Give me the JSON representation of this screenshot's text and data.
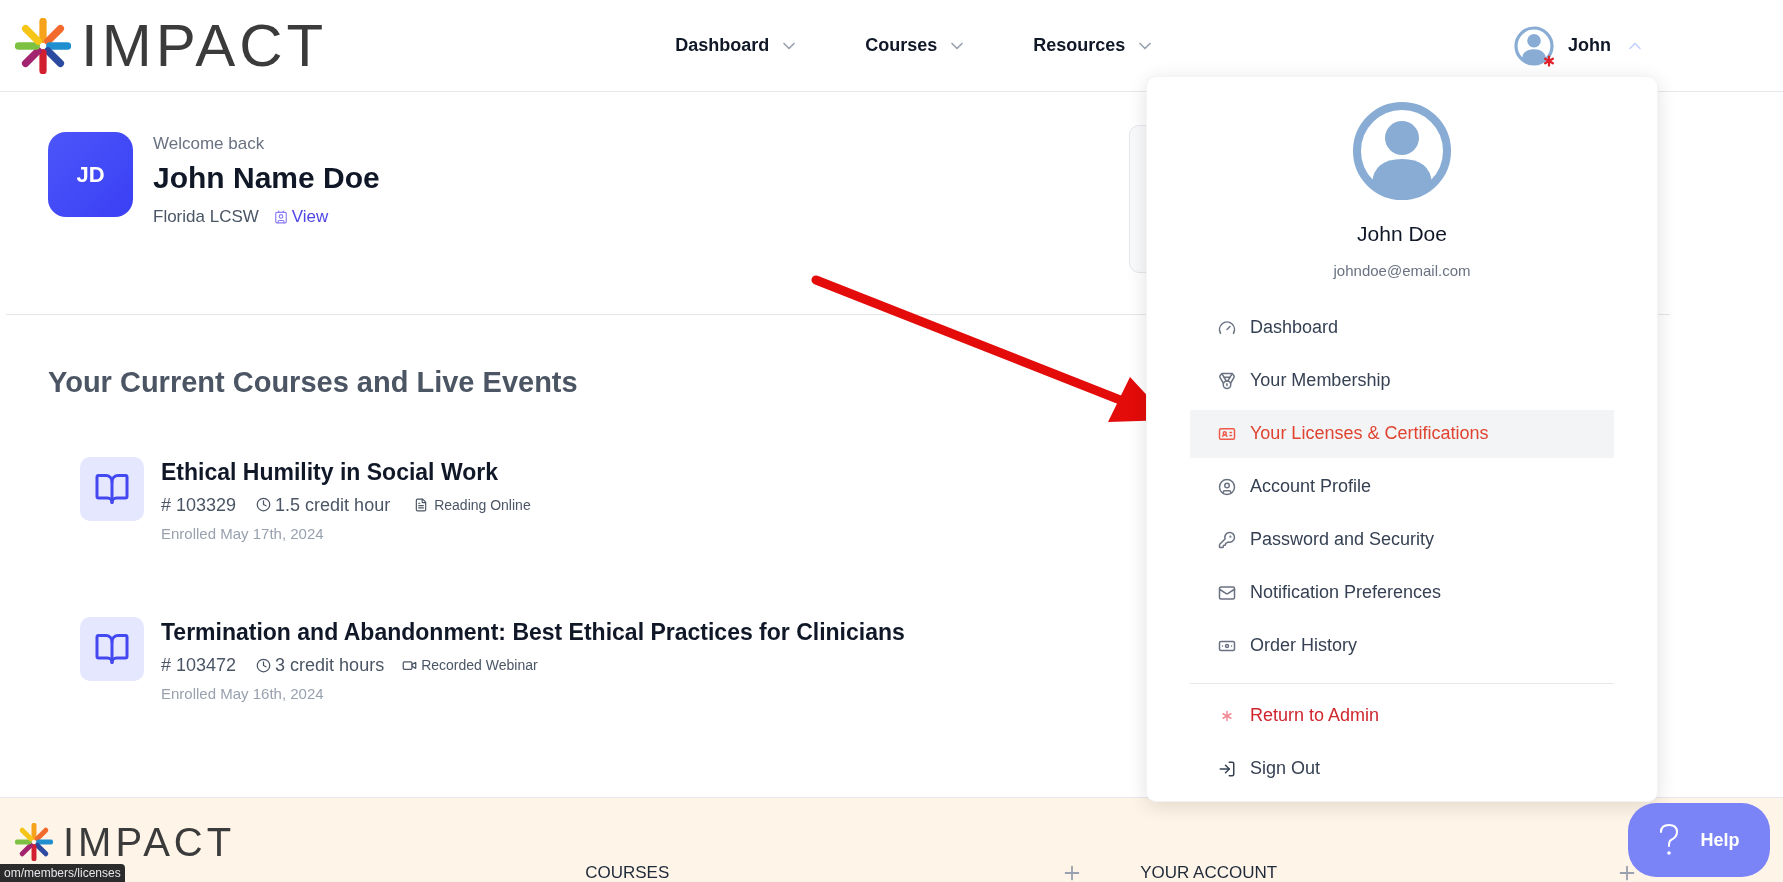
{
  "header": {
    "logo_text": "IMPACT",
    "nav": [
      {
        "label": "Dashboard"
      },
      {
        "label": "Courses"
      },
      {
        "label": "Resources"
      }
    ],
    "user": {
      "name": "John",
      "expanded": true
    }
  },
  "profile": {
    "initials": "JD",
    "greeting": "Welcome back",
    "name": "John Name Doe",
    "license": "Florida LCSW",
    "view_link": "View"
  },
  "section_title": "Your Current Courses and Live Events",
  "courses": [
    {
      "title": "Ethical Humility in Social Work",
      "number": "# 103329",
      "credits": "1.5 credit hour",
      "format": {
        "kind": "reading",
        "label": "Reading Online"
      },
      "enrolled": "Enrolled May 17th, 2024"
    },
    {
      "title": "Termination and Abandonment: Best Ethical Practices for Clinicians",
      "number": "# 103472",
      "credits": "3 credit hours",
      "format": {
        "kind": "webinar",
        "label": "Recorded Webinar"
      },
      "enrolled": "Enrolled May 16th, 2024"
    }
  ],
  "dropdown": {
    "name": "John Doe",
    "email": "johndoe@email.com",
    "items": [
      {
        "label": "Dashboard",
        "selected": false
      },
      {
        "label": "Your Membership",
        "selected": false
      },
      {
        "label": "Your Licenses & Certifications",
        "selected": true
      },
      {
        "label": "Account Profile",
        "selected": false
      },
      {
        "label": "Password and Security",
        "selected": false
      },
      {
        "label": "Notification Preferences",
        "selected": false
      },
      {
        "label": "Order History",
        "selected": false
      }
    ],
    "footer_items": [
      {
        "label": "Return to Admin",
        "kind": "admin"
      },
      {
        "label": "Sign Out",
        "kind": "normal"
      }
    ]
  },
  "footer": {
    "logo_text": "IMPACT",
    "columns": [
      {
        "label": "COURSES"
      },
      {
        "label": "YOUR ACCOUNT"
      }
    ]
  },
  "help_button": "Help",
  "status_url": "om/members/licenses"
}
